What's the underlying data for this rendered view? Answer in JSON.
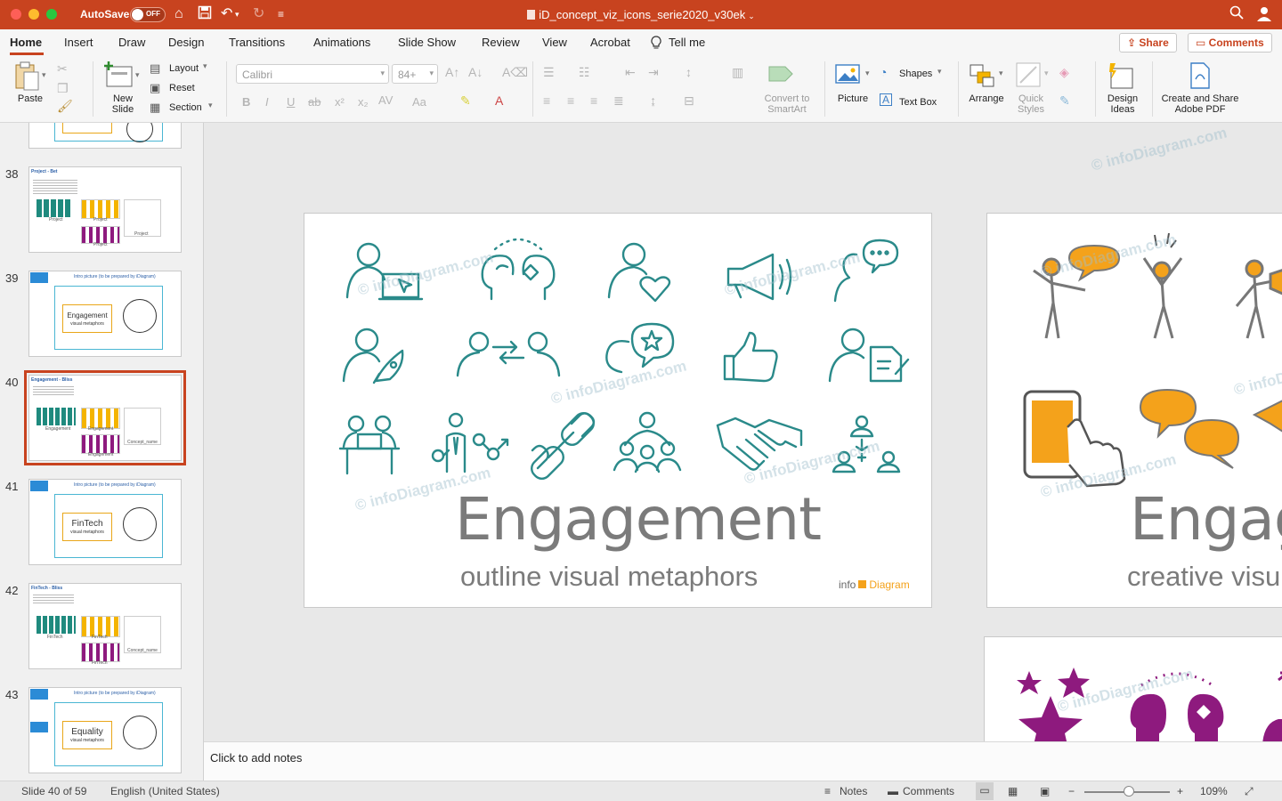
{
  "titlebar": {
    "autosave_label": "AutoSave",
    "toggle_state": "OFF",
    "document_title": "iD_concept_viz_icons_serie2020_v30ek"
  },
  "menu": {
    "items": [
      "Home",
      "Insert",
      "Draw",
      "Design",
      "Transitions",
      "Animations",
      "Slide Show",
      "Review",
      "View",
      "Acrobat"
    ],
    "tell_me": "Tell me",
    "share": "Share",
    "comments": "Comments"
  },
  "ribbon": {
    "paste": "Paste",
    "new_slide": "New\nSlide",
    "layout": "Layout",
    "reset": "Reset",
    "section": "Section",
    "font_name": "Calibri",
    "font_size": "84+",
    "convert_smartart": "Convert to\nSmartArt",
    "picture": "Picture",
    "shapes": "Shapes",
    "text_box": "Text Box",
    "arrange": "Arrange",
    "quick_styles": "Quick\nStyles",
    "design_ideas": "Design\nIdeas",
    "create_share_pdf": "Create and Share\nAdobe PDF"
  },
  "thumbnails": [
    {
      "num": "38",
      "title": "Project - Bet",
      "captions": [
        "Project",
        "Project",
        "Project",
        "Project"
      ]
    },
    {
      "num": "39",
      "main": "Engagement",
      "sub": "visual metaphors",
      "header": "Intro picture (to be prepared by iDiagram)"
    },
    {
      "num": "40",
      "title": "Engagement - Bliss",
      "captions": [
        "Engagement",
        "Engagement",
        "Engagement",
        "Concept_name"
      ],
      "selected": true
    },
    {
      "num": "41",
      "main": "FinTech",
      "sub": "visual metaphors",
      "header": "Intro picture (to be prepared by iDiagram)"
    },
    {
      "num": "42",
      "title": "FinTech - Bliss",
      "captions": [
        "FinTech",
        "FinTech",
        "FinTech",
        "Concept_name"
      ]
    },
    {
      "num": "43",
      "main": "Equality",
      "sub": "visual metaphors",
      "header": "Intro picture (to be prepared by iDiagram)"
    }
  ],
  "slides": {
    "main_title": "Engagement",
    "main_subtitle": "outline visual metaphors",
    "logo_info": "info",
    "logo_diagram": "Diagram",
    "watermark": "© infoDiagram.com",
    "right_title": "Engag",
    "right_subtitle": "creative visu"
  },
  "notes_placeholder": "Click to add notes",
  "status": {
    "slide_counter": "Slide 40 of 59",
    "language": "English (United States)",
    "notes": "Notes",
    "comments": "Comments",
    "zoom": "109%"
  },
  "colors": {
    "accent": "#c8431f",
    "teal_icon": "#2a8a8a",
    "orange_icon": "#f4a21b",
    "purple_icon": "#8e1a7e"
  }
}
